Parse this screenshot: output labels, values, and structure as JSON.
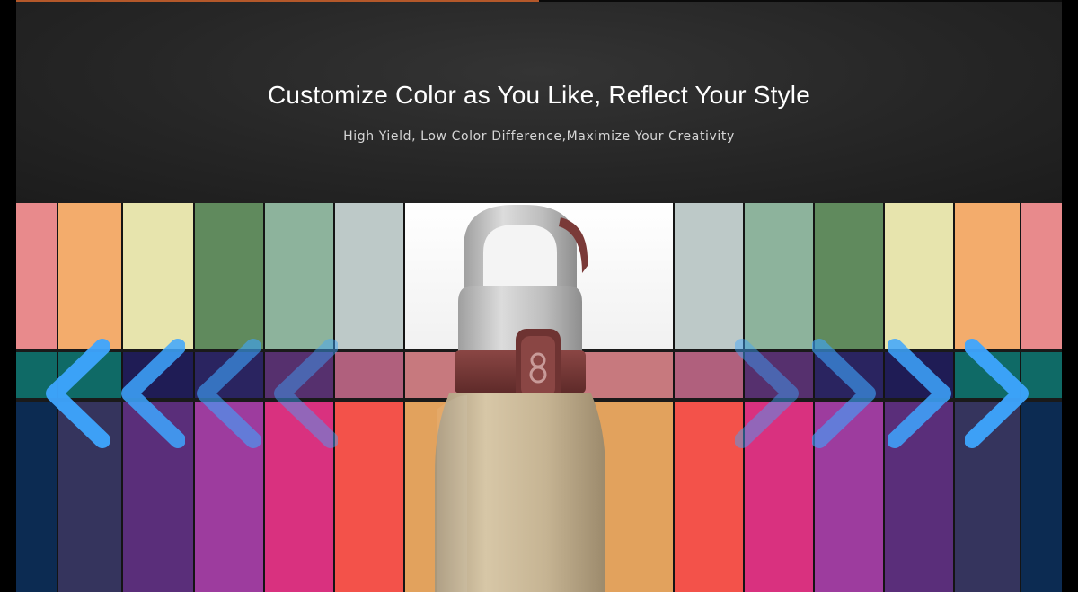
{
  "banner": {
    "headline": "Customize Color as You Like, Reflect Your Style",
    "subline": "High Yield, Low Color Difference,Maximize Your Creativity"
  },
  "colors": {
    "accent_top": "#b4582a",
    "arrow": "#3ea6ff",
    "strap": "#7a3a38",
    "bottle_body": "#c9b694",
    "lid": "#c4c4c4"
  },
  "swatch_columns": [
    {
      "top": "#e88a8c",
      "mid": "#0f6a66",
      "bottom": "#0c2b52"
    },
    {
      "top": "#f3ac6c",
      "mid": "#0f6a66",
      "bottom": "#35345d"
    },
    {
      "top": "#e7e4ad",
      "mid": "#1f1c55",
      "bottom": "#5a2e7a"
    },
    {
      "top": "#608a5d",
      "mid": "#2a2460",
      "bottom": "#9d3c9e"
    },
    {
      "top": "#8db39c",
      "mid": "#56306e",
      "bottom": "#d9317f"
    },
    {
      "top": "#bdc9c8",
      "mid": "#b0607d",
      "bottom": "#f3524a"
    },
    {
      "top": "#ffffff",
      "mid": "#c7797e",
      "bottom": "#e2a25d"
    },
    {
      "top": "#bdc9c8",
      "mid": "#b0607d",
      "bottom": "#f3524a"
    },
    {
      "top": "#8db39c",
      "mid": "#56306e",
      "bottom": "#d9317f"
    },
    {
      "top": "#608a5d",
      "mid": "#2a2460",
      "bottom": "#9d3c9e"
    },
    {
      "top": "#e7e4ad",
      "mid": "#1f1c55",
      "bottom": "#5a2e7a"
    },
    {
      "top": "#f3ac6c",
      "mid": "#0f6a66",
      "bottom": "#35345d"
    },
    {
      "top": "#e88a8c",
      "mid": "#0f6a66",
      "bottom": "#0c2b52"
    }
  ],
  "arrows": {
    "left": [
      "chevron-left-icon",
      "chevron-left-icon",
      "chevron-left-icon",
      "chevron-left-icon"
    ],
    "right": [
      "chevron-right-icon",
      "chevron-right-icon",
      "chevron-right-icon",
      "chevron-right-icon"
    ],
    "opacity_left": [
      0.95,
      0.85,
      0.6,
      0.45
    ],
    "opacity_right": [
      0.45,
      0.6,
      0.85,
      0.95
    ]
  }
}
